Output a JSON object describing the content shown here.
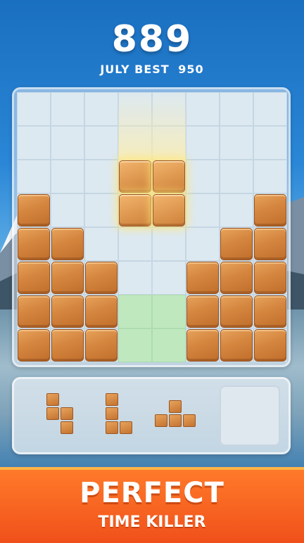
{
  "score": "889",
  "best": {
    "label": "JULY BEST",
    "value": "950"
  },
  "board": {
    "cols": 8,
    "rows": 8,
    "placed_blocks": [
      [
        0,
        3
      ],
      [
        0,
        4
      ],
      [
        0,
        5
      ],
      [
        0,
        6
      ],
      [
        0,
        7
      ],
      [
        1,
        4
      ],
      [
        1,
        5
      ],
      [
        1,
        6
      ],
      [
        1,
        7
      ],
      [
        2,
        5
      ],
      [
        2,
        6
      ],
      [
        2,
        7
      ],
      [
        5,
        5
      ],
      [
        5,
        6
      ],
      [
        5,
        7
      ],
      [
        6,
        4
      ],
      [
        6,
        5
      ],
      [
        6,
        6
      ],
      [
        6,
        7
      ],
      [
        7,
        3
      ],
      [
        7,
        4
      ],
      [
        7,
        5
      ],
      [
        7,
        6
      ],
      [
        7,
        7
      ]
    ],
    "ghost_piece": [
      [
        3,
        2
      ],
      [
        4,
        2
      ],
      [
        3,
        3
      ],
      [
        4,
        3
      ]
    ],
    "highlight_cells": [
      [
        3,
        6
      ],
      [
        4,
        6
      ],
      [
        3,
        7
      ],
      [
        4,
        7
      ]
    ]
  },
  "pieces": [
    {
      "name": "s-piece",
      "cells": [
        [
          0,
          0
        ],
        [
          0,
          1
        ],
        [
          1,
          1
        ],
        [
          1,
          2
        ]
      ]
    },
    {
      "name": "l-piece",
      "cells": [
        [
          0,
          0
        ],
        [
          0,
          1
        ],
        [
          0,
          2
        ],
        [
          1,
          2
        ]
      ]
    },
    {
      "name": "t-piece",
      "cells": [
        [
          1,
          0
        ],
        [
          0,
          1
        ],
        [
          1,
          1
        ],
        [
          2,
          1
        ]
      ]
    }
  ],
  "banner": {
    "headline": "PERFECT",
    "tagline": "TIME KILLER"
  },
  "colors": {
    "wood": "#d4853e",
    "accent": "#f0501a",
    "highlight": "#bfe8bf"
  }
}
